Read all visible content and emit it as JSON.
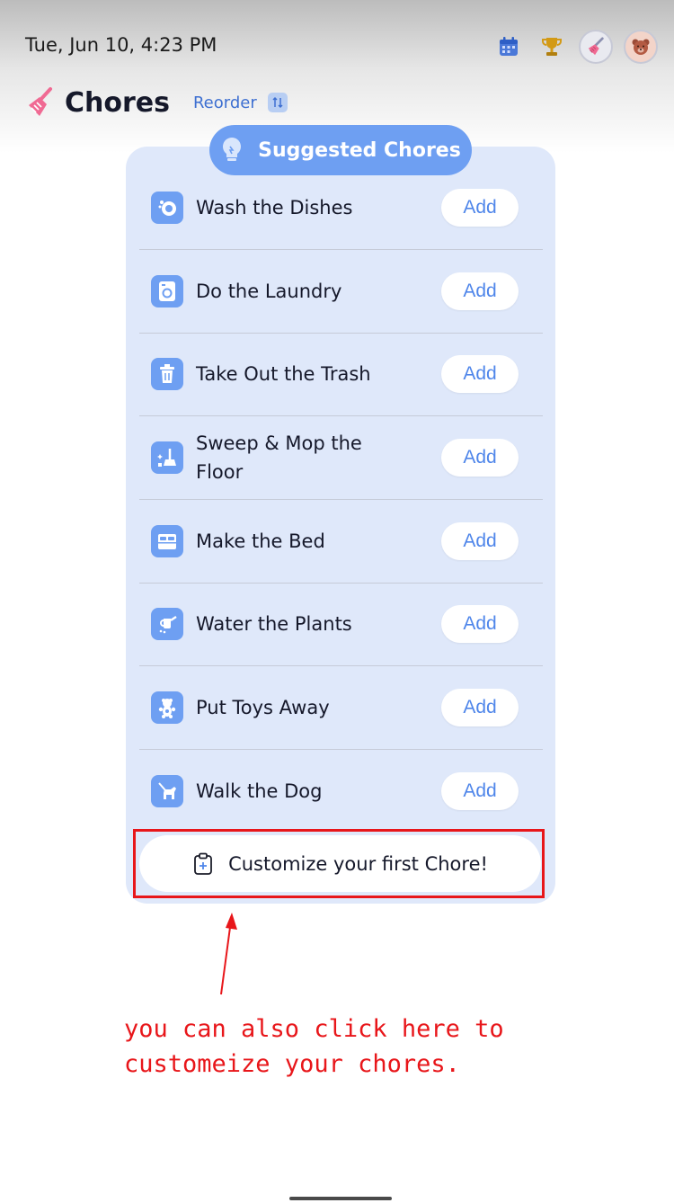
{
  "status_bar": {
    "datetime": "Tue, Jun 10, 4:23 PM"
  },
  "top_icons": [
    "calendar-icon",
    "trophy-icon",
    "broom-avatar-icon",
    "bear-avatar-icon"
  ],
  "header": {
    "title": "Chores",
    "reorder_label": "Reorder"
  },
  "suggested": {
    "title": "Suggested Chores"
  },
  "chores": [
    {
      "label": "Wash the Dishes",
      "icon": "dishes-icon",
      "action": "Add"
    },
    {
      "label": "Do the Laundry",
      "icon": "washing-machine-icon",
      "action": "Add"
    },
    {
      "label": "Take Out the Trash",
      "icon": "trash-icon",
      "action": "Add"
    },
    {
      "label": "Sweep & Mop the Floor",
      "icon": "sweep-icon",
      "action": "Add"
    },
    {
      "label": "Make the Bed",
      "icon": "bed-icon",
      "action": "Add"
    },
    {
      "label": "Water the Plants",
      "icon": "watering-can-icon",
      "action": "Add"
    },
    {
      "label": "Put Toys Away",
      "icon": "teddy-bear-icon",
      "action": "Add"
    },
    {
      "label": "Walk the Dog",
      "icon": "dog-icon",
      "action": "Add"
    }
  ],
  "customize": {
    "label": "Customize your first Chore!"
  },
  "annotation": {
    "text": "you can also click here to\ncustomeize your chores."
  },
  "colors": {
    "accent": "#6e9ff2",
    "panel": "#dfe8fa",
    "highlight": "#e8161a",
    "brand_pink": "#f06a93"
  }
}
